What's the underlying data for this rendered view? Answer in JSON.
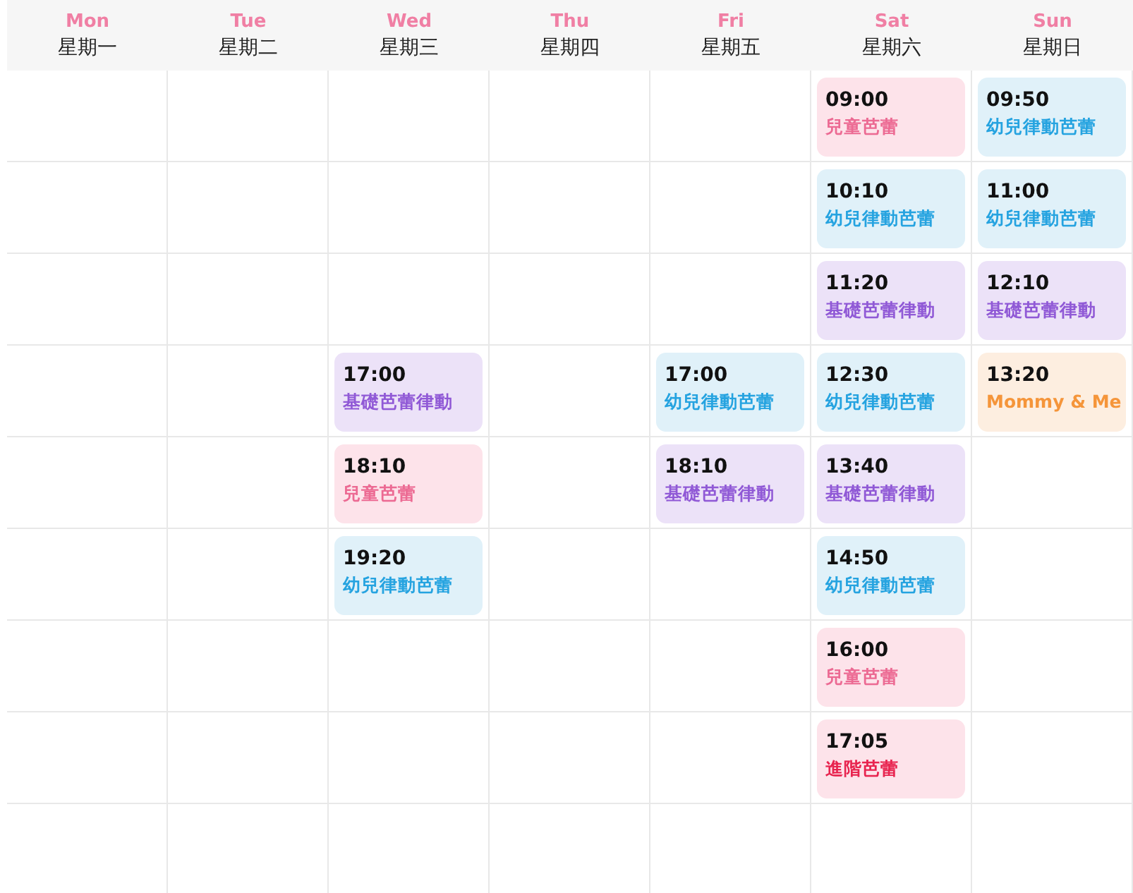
{
  "days": [
    {
      "abbr": "Mon",
      "name": "星期一"
    },
    {
      "abbr": "Tue",
      "name": "星期二"
    },
    {
      "abbr": "Wed",
      "name": "星期三"
    },
    {
      "abbr": "Thu",
      "name": "星期四"
    },
    {
      "abbr": "Fri",
      "name": "星期五"
    },
    {
      "abbr": "Sat",
      "name": "星期六"
    },
    {
      "abbr": "Sun",
      "name": "星期日"
    }
  ],
  "rows": [
    [
      null,
      null,
      null,
      null,
      null,
      {
        "time": "09:00",
        "title": "兒童芭蕾",
        "kind": "kids"
      },
      {
        "time": "09:50",
        "title": "幼兒律動芭蕾",
        "kind": "toddler"
      }
    ],
    [
      null,
      null,
      null,
      null,
      null,
      {
        "time": "10:10",
        "title": "幼兒律動芭蕾",
        "kind": "toddler"
      },
      {
        "time": "11:00",
        "title": "幼兒律動芭蕾",
        "kind": "toddler"
      }
    ],
    [
      null,
      null,
      null,
      null,
      null,
      {
        "time": "11:20",
        "title": "基礎芭蕾律動",
        "kind": "basic"
      },
      {
        "time": "12:10",
        "title": "基礎芭蕾律動",
        "kind": "basic"
      }
    ],
    [
      null,
      null,
      {
        "time": "17:00",
        "title": "基礎芭蕾律動",
        "kind": "basic"
      },
      null,
      {
        "time": "17:00",
        "title": "幼兒律動芭蕾",
        "kind": "toddler"
      },
      {
        "time": "12:30",
        "title": "幼兒律動芭蕾",
        "kind": "toddler"
      },
      {
        "time": "13:20",
        "title": "Mommy & Me",
        "kind": "mommy"
      }
    ],
    [
      null,
      null,
      {
        "time": "18:10",
        "title": "兒童芭蕾",
        "kind": "kids"
      },
      null,
      {
        "time": "18:10",
        "title": "基礎芭蕾律動",
        "kind": "basic"
      },
      {
        "time": "13:40",
        "title": "基礎芭蕾律動",
        "kind": "basic"
      },
      null
    ],
    [
      null,
      null,
      {
        "time": "19:20",
        "title": "幼兒律動芭蕾",
        "kind": "toddler"
      },
      null,
      null,
      {
        "time": "14:50",
        "title": "幼兒律動芭蕾",
        "kind": "toddler"
      },
      null
    ],
    [
      null,
      null,
      null,
      null,
      null,
      {
        "time": "16:00",
        "title": "兒童芭蕾",
        "kind": "kids"
      },
      null
    ],
    [
      null,
      null,
      null,
      null,
      null,
      {
        "time": "17:05",
        "title": "進階芭蕾",
        "kind": "advanced"
      },
      null
    ],
    [
      null,
      null,
      null,
      null,
      null,
      null,
      null
    ]
  ]
}
